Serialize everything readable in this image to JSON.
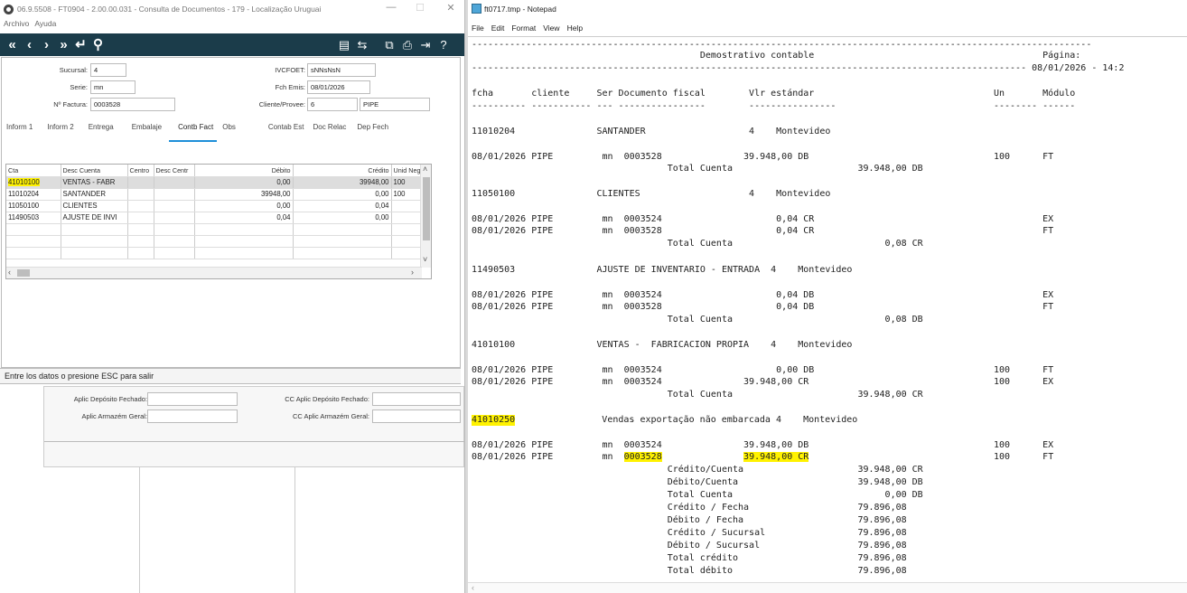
{
  "left_window": {
    "title": "06.9.5508 - FT0904 - 2.00.00.031 - Consulta de Documentos - 179 - Localização Uruguai",
    "controls": {
      "minimize": "—",
      "maximize": "☐",
      "close": "✕"
    },
    "menu": [
      "Archivo",
      "Ayuda"
    ],
    "toolbar_icons": [
      "first-icon",
      "prev-icon",
      "next-icon",
      "last-icon",
      "return-icon",
      "search-icon"
    ],
    "form": {
      "sucursal_label": "Sucursal:",
      "sucursal_value": "4",
      "serie_label": "Serie:",
      "serie_value": "mn",
      "nfactura_label": "Nº Factura:",
      "nfactura_value": "0003528",
      "ivcfoet_label": "IVCFOET:",
      "ivcfoet_value": "sNNsNsN",
      "fchemis_label": "Fch Emis:",
      "fchemis_value": "08/01/2026",
      "cliente_label": "Cliente/Provee:",
      "cliente_value": "6",
      "cliente_name": "PIPE"
    },
    "tabs": [
      "Inform 1",
      "Inform 2",
      "Entrega",
      "Embalaje",
      "Contb Fact",
      "Obs",
      "Contab Est",
      "Doc Relac",
      "Dep Fech"
    ],
    "active_tab": "Contb Fact",
    "grid": {
      "headers": [
        "Cta",
        "Desc Cuenta",
        "Centro",
        "Desc Centr",
        "Débito",
        "Crédito",
        "Unid Neg"
      ],
      "rows": [
        [
          "41010100",
          "VENTAS -  FABR",
          "",
          "",
          "0,00",
          "39948,00",
          "100"
        ],
        [
          "11010204",
          "SANTANDER",
          "",
          "",
          "39948,00",
          "0,00",
          "100"
        ],
        [
          "11050100",
          "CLIENTES",
          "",
          "",
          "0,00",
          "0,04",
          ""
        ],
        [
          "11490503",
          "AJUSTE DE INVI",
          "",
          "",
          "0,04",
          "0,00",
          ""
        ]
      ]
    },
    "status_text": "Entre los datos o presione ESC para salir",
    "bottom": {
      "aplic_dep_label": "Aplic Depósito Fechado:",
      "aplic_arm_label": "Aplic Armazém Geral:",
      "cc_aplic_dep_label": "CC Aplic Depósito Fechado:",
      "cc_aplic_arm_label": "CC Aplic Armazém Geral:"
    }
  },
  "notepad": {
    "title": "ft0717.tmp - Notepad",
    "menu": [
      "File",
      "Edit",
      "Format",
      "View",
      "Help"
    ],
    "lines": [
      "------------------------------------------------------------------------------------------------------------------",
      "                                          Demostrativo contable                                          Página:",
      "------------------------------------------------------------------------------------------------------ 08/01/2026 - 14:2",
      "fcha       cliente     Ser Documento fiscal        Vlr estándar                                 Un       Módulo",
      "---------- ----------- --- ----------------        ----------------                             -------- ------",
      "11010204               SANTANDER                   4    Montevideo",
      "08/01/2026 PIPE         mn  0003528               39.948,00 DB                                  100      FT",
      "                                    Total Cuenta                       39.948,00 DB",
      "11050100               CLIENTES                    4    Montevideo",
      "08/01/2026 PIPE         mn  0003524                     0,04 CR                                          EX",
      "08/01/2026 PIPE         mn  0003528                     0,04 CR                                          FT",
      "                                    Total Cuenta                            0,08 CR",
      "11490503               AJUSTE DE INVENTARIO - ENTRADA  4    Montevideo",
      "08/01/2026 PIPE         mn  0003524                     0,04 DB                                          EX",
      "08/01/2026 PIPE         mn  0003528                     0,04 DB                                          FT",
      "                                    Total Cuenta                            0,08 DB",
      "41010100               VENTAS -  FABRICACION PROPIA    4    Montevideo",
      "08/01/2026 PIPE         mn  0003524                     0,00 DB                                 100      FT",
      "08/01/2026 PIPE         mn  0003524               39.948,00 CR                                  100      EX",
      "                                    Total Cuenta                       39.948,00 CR",
      "41010250               Vendas exportação não embarcada 4    Montevideo",
      "08/01/2026 PIPE         mn  0003524               39.948,00 DB                                  100      EX",
      "08/01/2026 PIPE         mn  0003528               39.948,00 CR                                  100      FT",
      "                                    Crédito/Cuenta                     39.948,00 CR",
      "                                    Débito/Cuenta                      39.948,00 DB",
      "                                    Total Cuenta                            0,00 DB",
      "                                    Crédito / Fecha                    79.896,08",
      "                                    Débito / Fecha                     79.896,08",
      "                                    Crédito / Sucursal                 79.896,08",
      "                                    Débito / Sucursal                  79.896,08",
      "                                    Total crédito                      79.896,08",
      "                                    Total débito                       79.896,08"
    ],
    "highlights": [
      "41010250",
      "0003528",
      "39.948,00 CR"
    ],
    "highlight_color": "#fff200"
  }
}
